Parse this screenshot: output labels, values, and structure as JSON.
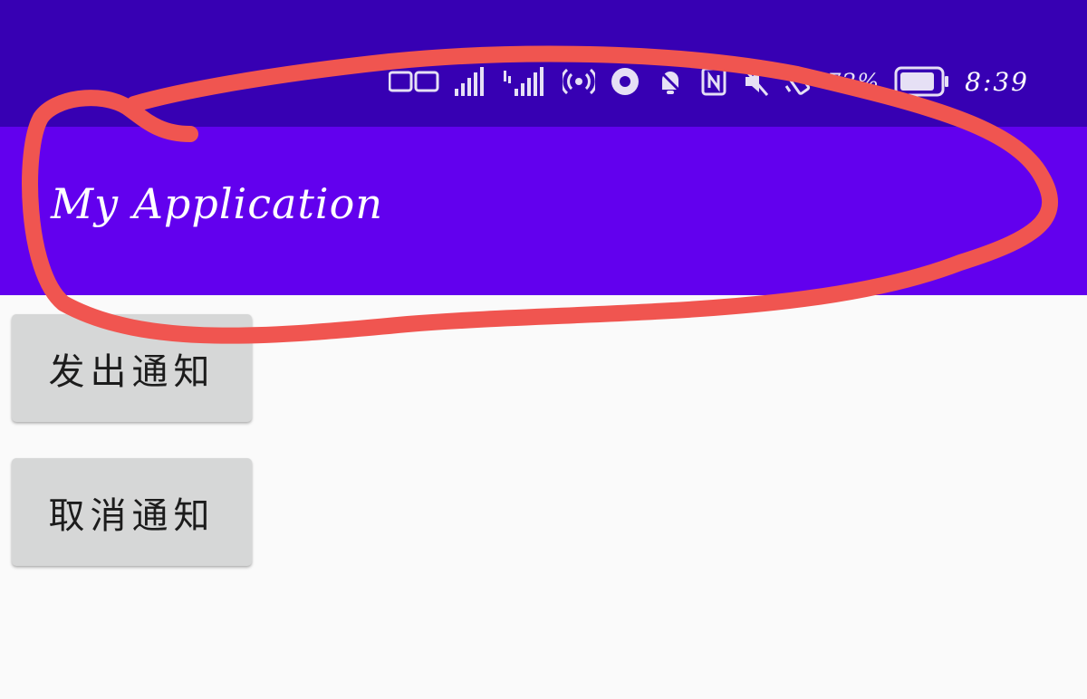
{
  "status_bar": {
    "background": "#3700b3",
    "battery_percent": "72%",
    "time": "8:39",
    "icons": [
      "hd-icon",
      "signal-icon",
      "signal-icon",
      "hotspot-icon",
      "eye-icon",
      "notification-off-icon",
      "nfc-icon",
      "mute-icon",
      "vibrate-icon",
      "battery-icon"
    ]
  },
  "app_bar": {
    "title": "My Application",
    "background": "#6200ee"
  },
  "buttons": {
    "send_notification": "发出通知",
    "cancel_notification": "取消通知"
  },
  "annotation": {
    "color": "#f05550",
    "shape": "hand-drawn red loop circling the app bar title"
  }
}
